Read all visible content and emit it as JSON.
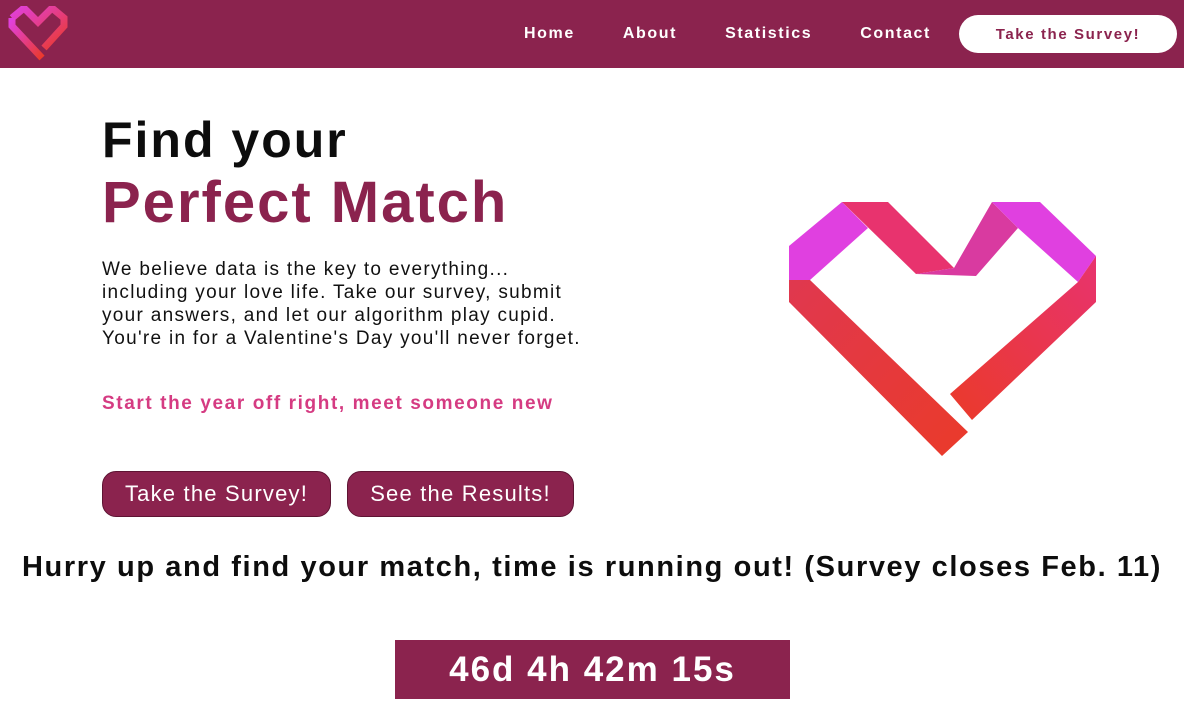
{
  "nav": {
    "logo_icon": "heart-logo-icon",
    "links": [
      "Home",
      "About",
      "Statistics",
      "Contact"
    ],
    "cta_label": "Take the Survey!"
  },
  "hero": {
    "title_line1": "Find your",
    "title_line2": "Perfect Match",
    "description": "We believe data is the key to everything... including your love life. Take our survey, submit your answers, and let our algorithm play cupid. You're in for a Valentine's Day you'll never forget.",
    "tagline": "Start the year off right, meet someone new",
    "buttons": {
      "survey": "Take the Survey!",
      "results": "See the Results!"
    },
    "illustration_icon": "heart-illustration-icon"
  },
  "countdown": {
    "message": "Hurry up and find your match, time is running out! (Survey closes Feb. 11)",
    "timer": "46d 4h 42m 15s"
  },
  "colors": {
    "brand": "#8b234e",
    "tagline_pink": "#d53b82",
    "heart_magenta": "#e040e0",
    "heart_pink": "#e8336e",
    "heart_red": "#ea3a2a",
    "nav_text": "#ffffff"
  }
}
